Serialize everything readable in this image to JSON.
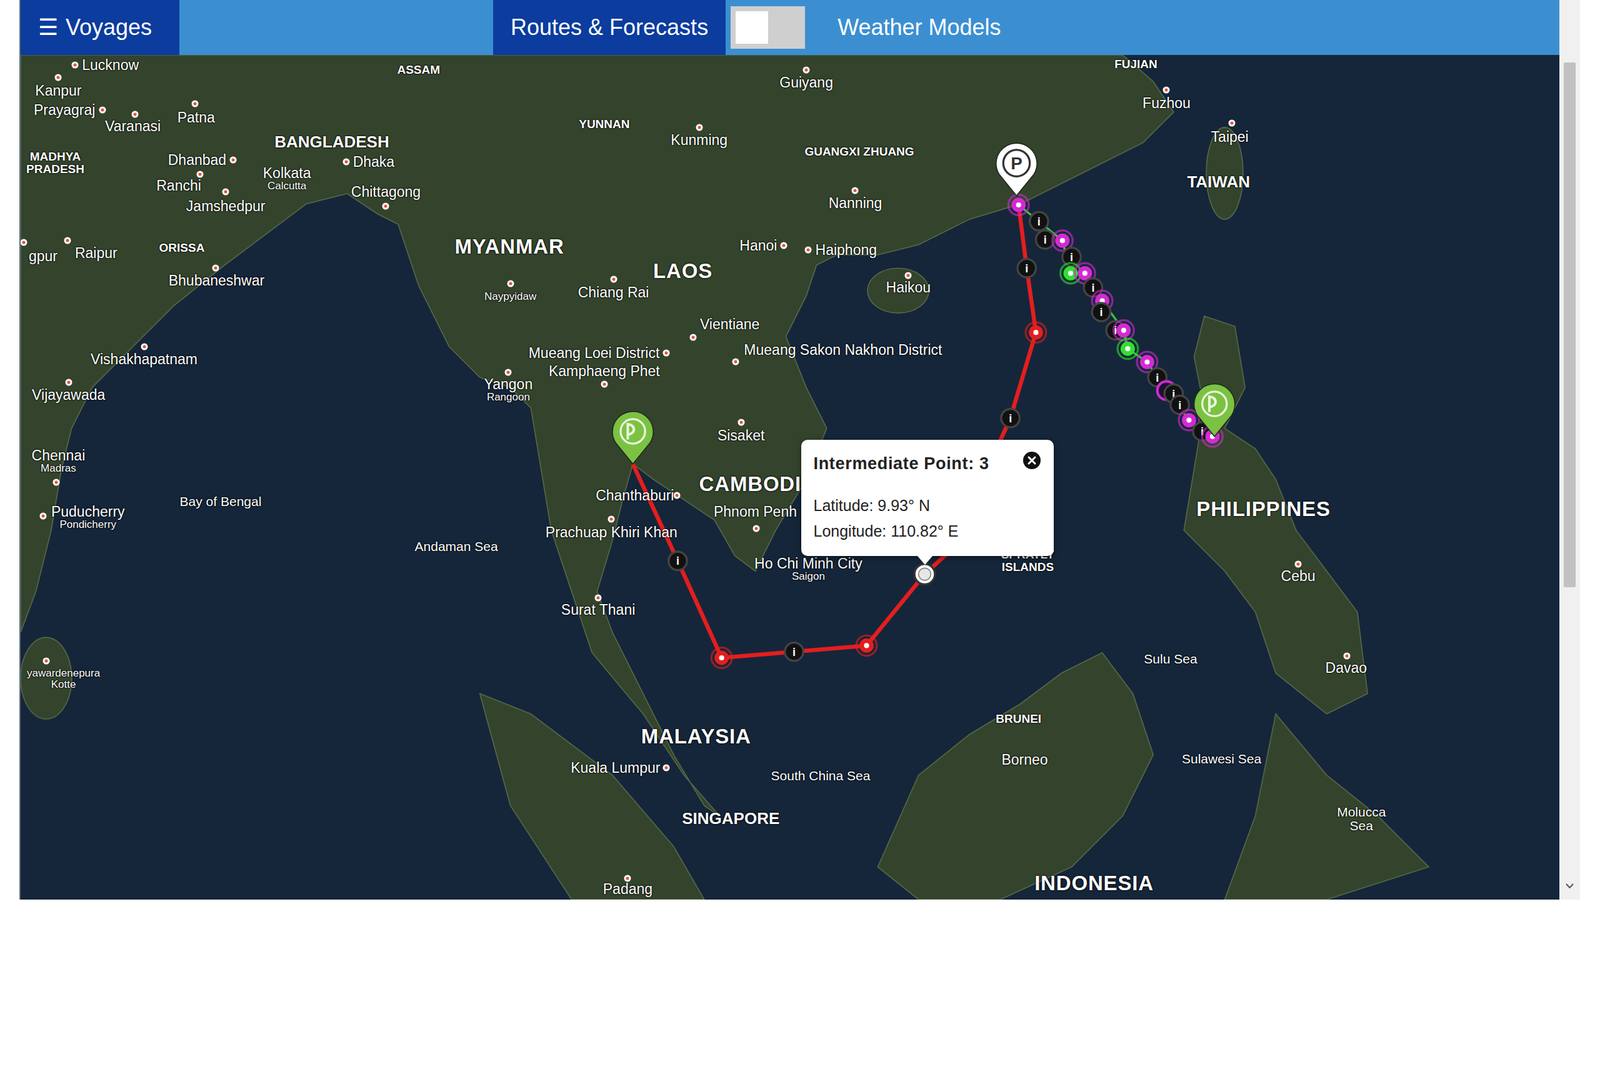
{
  "top_bar": {
    "menu_button": {
      "icon": "☰",
      "label": "Voyages"
    },
    "tabs": [
      {
        "label": "Routes & Forecasts",
        "selected": true
      },
      {
        "label": "Weather Models",
        "selected": false
      }
    ],
    "toggle": {
      "on": false
    }
  },
  "map": {
    "labels": [
      {
        "lines": [
          "Lucknow"
        ],
        "kind": "city"
      },
      {
        "lines": [
          "Kanpur"
        ],
        "kind": "city"
      },
      {
        "lines": [
          "Prayagraj"
        ],
        "kind": "city"
      },
      {
        "lines": [
          "Varanasi"
        ],
        "kind": "city"
      },
      {
        "lines": [
          "Patna"
        ],
        "kind": "city"
      },
      {
        "lines": [
          "ASSAM"
        ],
        "kind": "region"
      },
      {
        "lines": [
          "Guiyang"
        ],
        "kind": "city"
      },
      {
        "lines": [
          "FUJIAN"
        ],
        "kind": "region"
      },
      {
        "lines": [
          "Fuzhou"
        ],
        "kind": "city"
      },
      {
        "lines": [
          "Taipei"
        ],
        "kind": "city"
      },
      {
        "lines": [
          "TAIWAN"
        ],
        "kind": "territory"
      },
      {
        "lines": [
          "YUNNAN"
        ],
        "kind": "region"
      },
      {
        "lines": [
          "Kunming"
        ],
        "kind": "city"
      },
      {
        "lines": [
          "GUANGXI ZHUANG"
        ],
        "kind": "region"
      },
      {
        "lines": [
          "BANGLADESH"
        ],
        "kind": "territory"
      },
      {
        "lines": [
          "MADHYA",
          "PRADESH"
        ],
        "kind": "region"
      },
      {
        "lines": [
          "Dhanbad"
        ],
        "kind": "city"
      },
      {
        "lines": [
          "Dhaka"
        ],
        "kind": "city"
      },
      {
        "lines": [
          "Kolkata"
        ],
        "sub": "Calcutta",
        "kind": "city"
      },
      {
        "lines": [
          "Ranchi"
        ],
        "kind": "city"
      },
      {
        "lines": [
          "Jamshedpur"
        ],
        "kind": "city"
      },
      {
        "lines": [
          "Chittagong"
        ],
        "kind": "city"
      },
      {
        "lines": [
          "Nanning"
        ],
        "kind": "city"
      },
      {
        "lines": [
          "MYANMAR"
        ],
        "kind": "country"
      },
      {
        "lines": [
          "Hanoi"
        ],
        "kind": "city"
      },
      {
        "lines": [
          "Haiphong"
        ],
        "kind": "city"
      },
      {
        "lines": [
          "LAOS"
        ],
        "kind": "country"
      },
      {
        "lines": [
          "Naypyidaw"
        ],
        "kind": "town"
      },
      {
        "lines": [
          "Chiang Rai"
        ],
        "kind": "city"
      },
      {
        "lines": [
          "Haikou"
        ],
        "kind": "city"
      },
      {
        "lines": [
          "ORISSA"
        ],
        "kind": "region"
      },
      {
        "lines": [
          "Raipur"
        ],
        "kind": "city"
      },
      {
        "lines": [
          "gpur"
        ],
        "kind": "city"
      },
      {
        "lines": [
          "Bhubaneshwar"
        ],
        "kind": "city"
      },
      {
        "lines": [
          "Vientiane"
        ],
        "kind": "city"
      },
      {
        "lines": [
          "Mueang Loei District"
        ],
        "kind": "city"
      },
      {
        "lines": [
          "Mueang Sakon Nakhon District"
        ],
        "kind": "city"
      },
      {
        "lines": [
          "Kamphaeng Phet"
        ],
        "kind": "city"
      },
      {
        "lines": [
          "Vishakhapatnam"
        ],
        "kind": "city"
      },
      {
        "lines": [
          "Yangon"
        ],
        "sub": "Rangoon",
        "kind": "city"
      },
      {
        "lines": [
          "Vijayawada"
        ],
        "kind": "city"
      },
      {
        "lines": [
          "Sisaket"
        ],
        "kind": "city"
      },
      {
        "lines": [
          "Chennai"
        ],
        "sub": "Madras",
        "kind": "city"
      },
      {
        "lines": [
          "CAMBODI"
        ],
        "kind": "country"
      },
      {
        "lines": [
          "Chanthaburi"
        ],
        "kind": "city"
      },
      {
        "lines": [
          "Phnom Penh"
        ],
        "kind": "city"
      },
      {
        "lines": [
          "Puducherry"
        ],
        "sub": "Pondicherry",
        "kind": "city"
      },
      {
        "lines": [
          "Bay of Bengal"
        ],
        "kind": "sea"
      },
      {
        "lines": [
          "Prachuap Khiri Khan"
        ],
        "kind": "city"
      },
      {
        "lines": [
          "Andaman Sea"
        ],
        "kind": "sea"
      },
      {
        "lines": [
          "Ho Chi Minh City"
        ],
        "sub": "Saigon",
        "kind": "city"
      },
      {
        "lines": [
          "SPRATLY",
          "ISLANDS"
        ],
        "kind": "region"
      },
      {
        "lines": [
          "PHILIPPINES"
        ],
        "kind": "country"
      },
      {
        "lines": [
          "Cebu"
        ],
        "kind": "city"
      },
      {
        "lines": [
          "Surat Thani"
        ],
        "kind": "city"
      },
      {
        "lines": [
          "Sulu Sea"
        ],
        "kind": "sea"
      },
      {
        "lines": [
          "Davao"
        ],
        "kind": "city"
      },
      {
        "lines": [
          "yawardenepura",
          "Kotte"
        ],
        "kind": "town"
      },
      {
        "lines": [
          "MALAYSIA"
        ],
        "kind": "country"
      },
      {
        "lines": [
          "BRUNEI"
        ],
        "kind": "region"
      },
      {
        "lines": [
          "Borneo"
        ],
        "kind": "city"
      },
      {
        "lines": [
          "Kuala Lumpur"
        ],
        "kind": "city"
      },
      {
        "lines": [
          "South China Sea"
        ],
        "kind": "sea"
      },
      {
        "lines": [
          "Sulawesi Sea"
        ],
        "kind": "sea"
      },
      {
        "lines": [
          "Molucca",
          "Sea"
        ],
        "kind": "sea"
      },
      {
        "lines": [
          "SINGAPORE"
        ],
        "kind": "territory"
      },
      {
        "lines": [
          "INDONESIA"
        ],
        "kind": "country"
      },
      {
        "lines": [
          "Padang"
        ],
        "kind": "city"
      }
    ],
    "pins": [
      {
        "name": "departure",
        "color": "#7cc242"
      },
      {
        "name": "port",
        "color": "#ffffff",
        "glyph": "P"
      },
      {
        "name": "arrival",
        "color": "#7cc242"
      }
    ],
    "info_glyph": "i",
    "routes": [
      {
        "name": "planned-route",
        "color": "#e41e1e",
        "markers": [
          {
            "kind": "info",
            "selected": false
          },
          {
            "kind": "waypoint",
            "selected": false
          },
          {
            "kind": "info",
            "selected": false
          },
          {
            "kind": "waypoint",
            "selected": false
          },
          {
            "kind": "waypoint",
            "selected": true
          },
          {
            "kind": "info",
            "selected": false
          },
          {
            "kind": "waypoint",
            "selected": false
          },
          {
            "kind": "info",
            "selected": false
          }
        ]
      },
      {
        "name": "forecast-route",
        "color": "#3ec43e",
        "markers": [
          {
            "kind": "dot",
            "color": "#d42ad4",
            "selected": false
          },
          {
            "kind": "info",
            "selected": false
          },
          {
            "kind": "info",
            "selected": false
          },
          {
            "kind": "dot",
            "color": "#d42ad4",
            "selected": false
          },
          {
            "kind": "info",
            "selected": false
          },
          {
            "kind": "dot",
            "color": "#2fe02f",
            "selected": false
          },
          {
            "kind": "dot",
            "color": "#d42ad4",
            "selected": false
          },
          {
            "kind": "info",
            "selected": false
          },
          {
            "kind": "dot",
            "color": "#d42ad4",
            "selected": false
          },
          {
            "kind": "info",
            "selected": false
          },
          {
            "kind": "info",
            "selected": false
          },
          {
            "kind": "dot",
            "color": "#d42ad4",
            "selected": false
          },
          {
            "kind": "dot",
            "color": "#2fe02f",
            "selected": false
          },
          {
            "kind": "dot",
            "color": "#d42ad4",
            "selected": false
          },
          {
            "kind": "info",
            "selected": false
          },
          {
            "kind": "ring",
            "color": "#d42ad4",
            "selected": false
          },
          {
            "kind": "info",
            "selected": false
          },
          {
            "kind": "info",
            "selected": false
          },
          {
            "kind": "dot",
            "color": "#d42ad4",
            "selected": false
          },
          {
            "kind": "info",
            "selected": false
          },
          {
            "kind": "dot",
            "color": "#d42ad4",
            "selected": false
          }
        ]
      }
    ],
    "popup": {
      "title": "Intermediate Point: 3",
      "lines": [
        "Latitude: 9.93° N",
        "Longitude: 110.82° E"
      ]
    }
  }
}
